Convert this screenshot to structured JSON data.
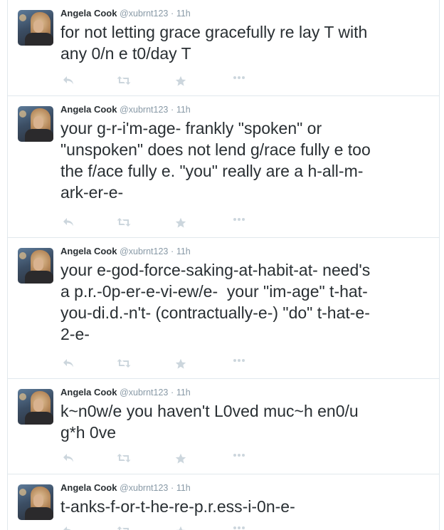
{
  "colors": {
    "name": "#292f33",
    "meta": "#8899a6",
    "text": "#292f33",
    "action_icon": "#ccd6dd",
    "divider": "#e1e8ed"
  },
  "icons": [
    "reply-icon",
    "retweet-icon",
    "favorite-icon",
    "more-icon"
  ],
  "tweets": [
    {
      "name": "Angela Cook",
      "handle": "@xubrnt123",
      "separator": "·",
      "time": "11h",
      "text": "for not letting grace gracefully re lay T with\nany 0/n e t0/day T"
    },
    {
      "name": "Angela Cook",
      "handle": "@xubrnt123",
      "separator": "·",
      "time": "11h",
      "text": "your g-r-i'm-age- frankly \"spoken\" or\n\"unspoken\" does not lend g/race fully e too\nthe f/ace fully e. \"you\" really are a h-all-m-\nark-er-e-"
    },
    {
      "name": "Angela Cook",
      "handle": "@xubrnt123",
      "separator": "·",
      "time": "11h",
      "text": "your e-god-force-saking-at-habit-at- need's\na p.r.-0p-er-e-vi-ew/e-  your \"im-age\" t-hat-\nyou-di.d.-n't- (contractually-e-) \"do\" t-hat-e-\n2-e-"
    },
    {
      "name": "Angela Cook",
      "handle": "@xubrnt123",
      "separator": "·",
      "time": "11h",
      "text": "k~n0w/e you haven't L0ved muc~h en0/u\ng*h 0ve"
    },
    {
      "name": "Angela Cook",
      "handle": "@xubrnt123",
      "separator": "·",
      "time": "11h",
      "text": "t-anks-f-or-t-he-re-p.r.ess-i-0n-e-"
    }
  ]
}
